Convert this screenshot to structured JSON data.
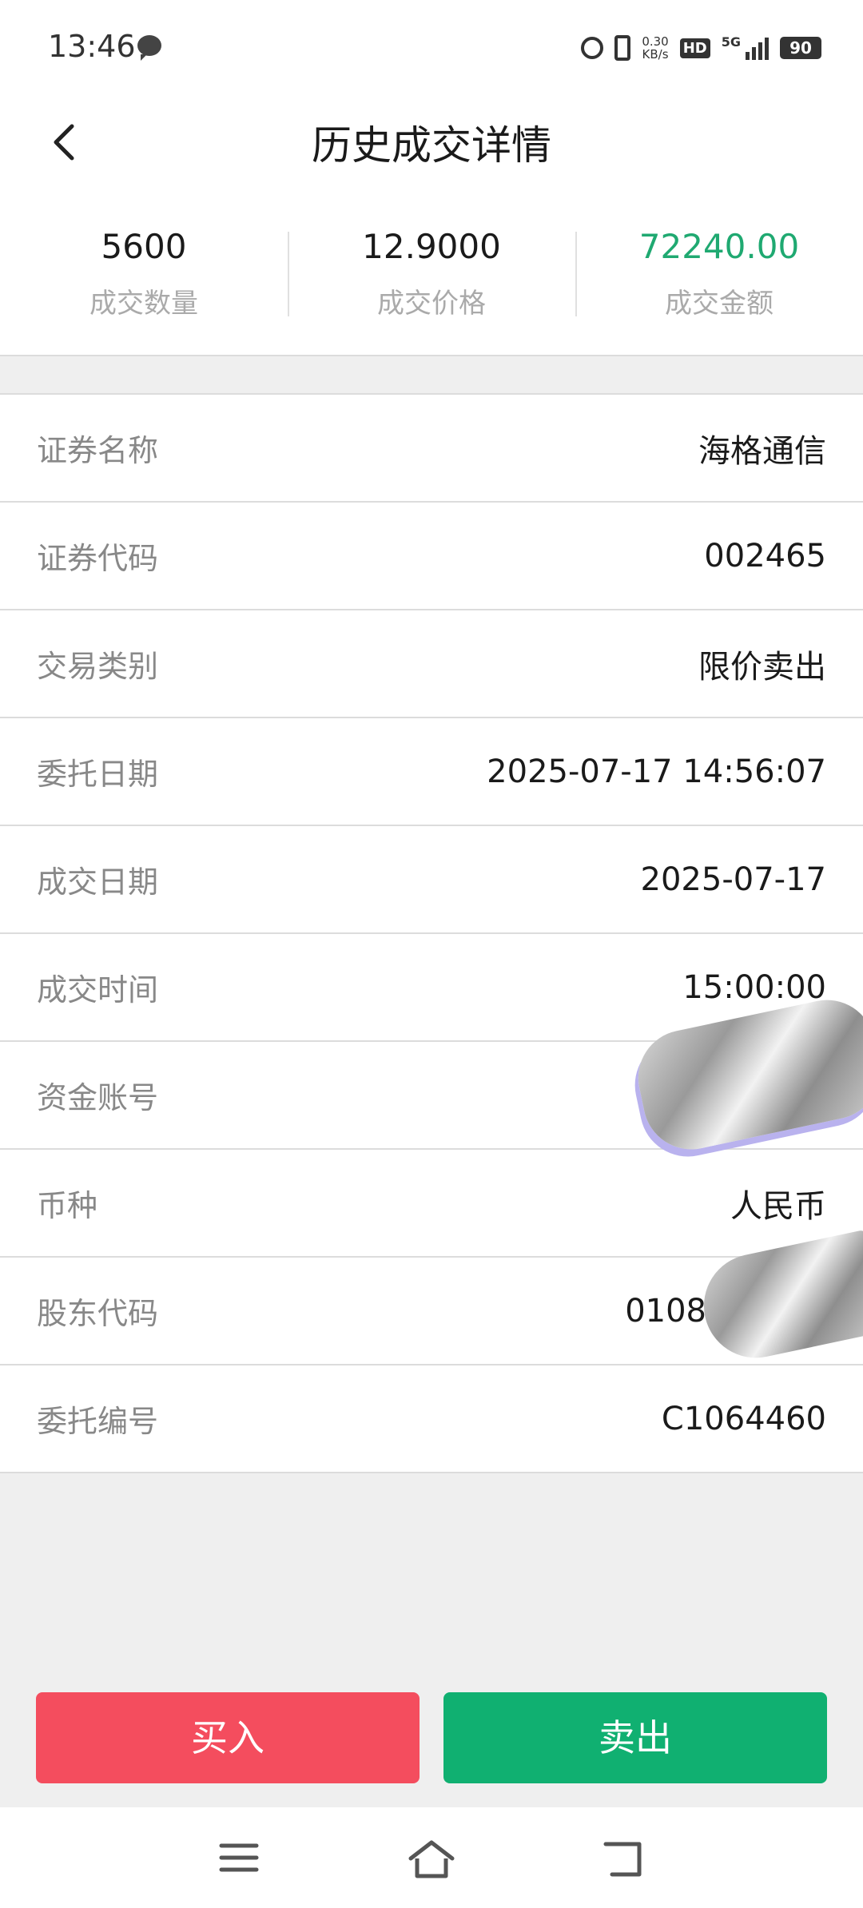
{
  "status_bar": {
    "time": "13:46",
    "speed_value": "0.30",
    "speed_unit": "KB/s",
    "hd": "HD",
    "network": "5G",
    "battery": "90"
  },
  "header": {
    "title": "历史成交详情"
  },
  "summary": [
    {
      "value": "5600",
      "label": "成交数量"
    },
    {
      "value": "12.9000",
      "label": "成交价格"
    },
    {
      "value": "72240.00",
      "label": "成交金额"
    }
  ],
  "details": [
    {
      "label": "证券名称",
      "value": "海格通信"
    },
    {
      "label": "证券代码",
      "value": "002465"
    },
    {
      "label": "交易类别",
      "value": "限价卖出"
    },
    {
      "label": "委托日期",
      "value": "2025-07-17 14:56:07"
    },
    {
      "label": "成交日期",
      "value": "2025-07-17"
    },
    {
      "label": "成交时间",
      "value": "15:00:00"
    },
    {
      "label": "资金账号",
      "value": ""
    },
    {
      "label": "币种",
      "value": "人民币"
    },
    {
      "label": "股东代码",
      "value": "0108"
    },
    {
      "label": "委托编号",
      "value": "C1064460"
    }
  ],
  "actions": {
    "buy_label": "买入",
    "sell_label": "卖出"
  },
  "colors": {
    "buy": "#f44d5e",
    "sell": "#10b071",
    "amount": "#1fa971"
  },
  "icons": {
    "back": "chevron-left-icon",
    "menu": "menu-icon",
    "home": "home-icon",
    "return": "return-icon"
  }
}
